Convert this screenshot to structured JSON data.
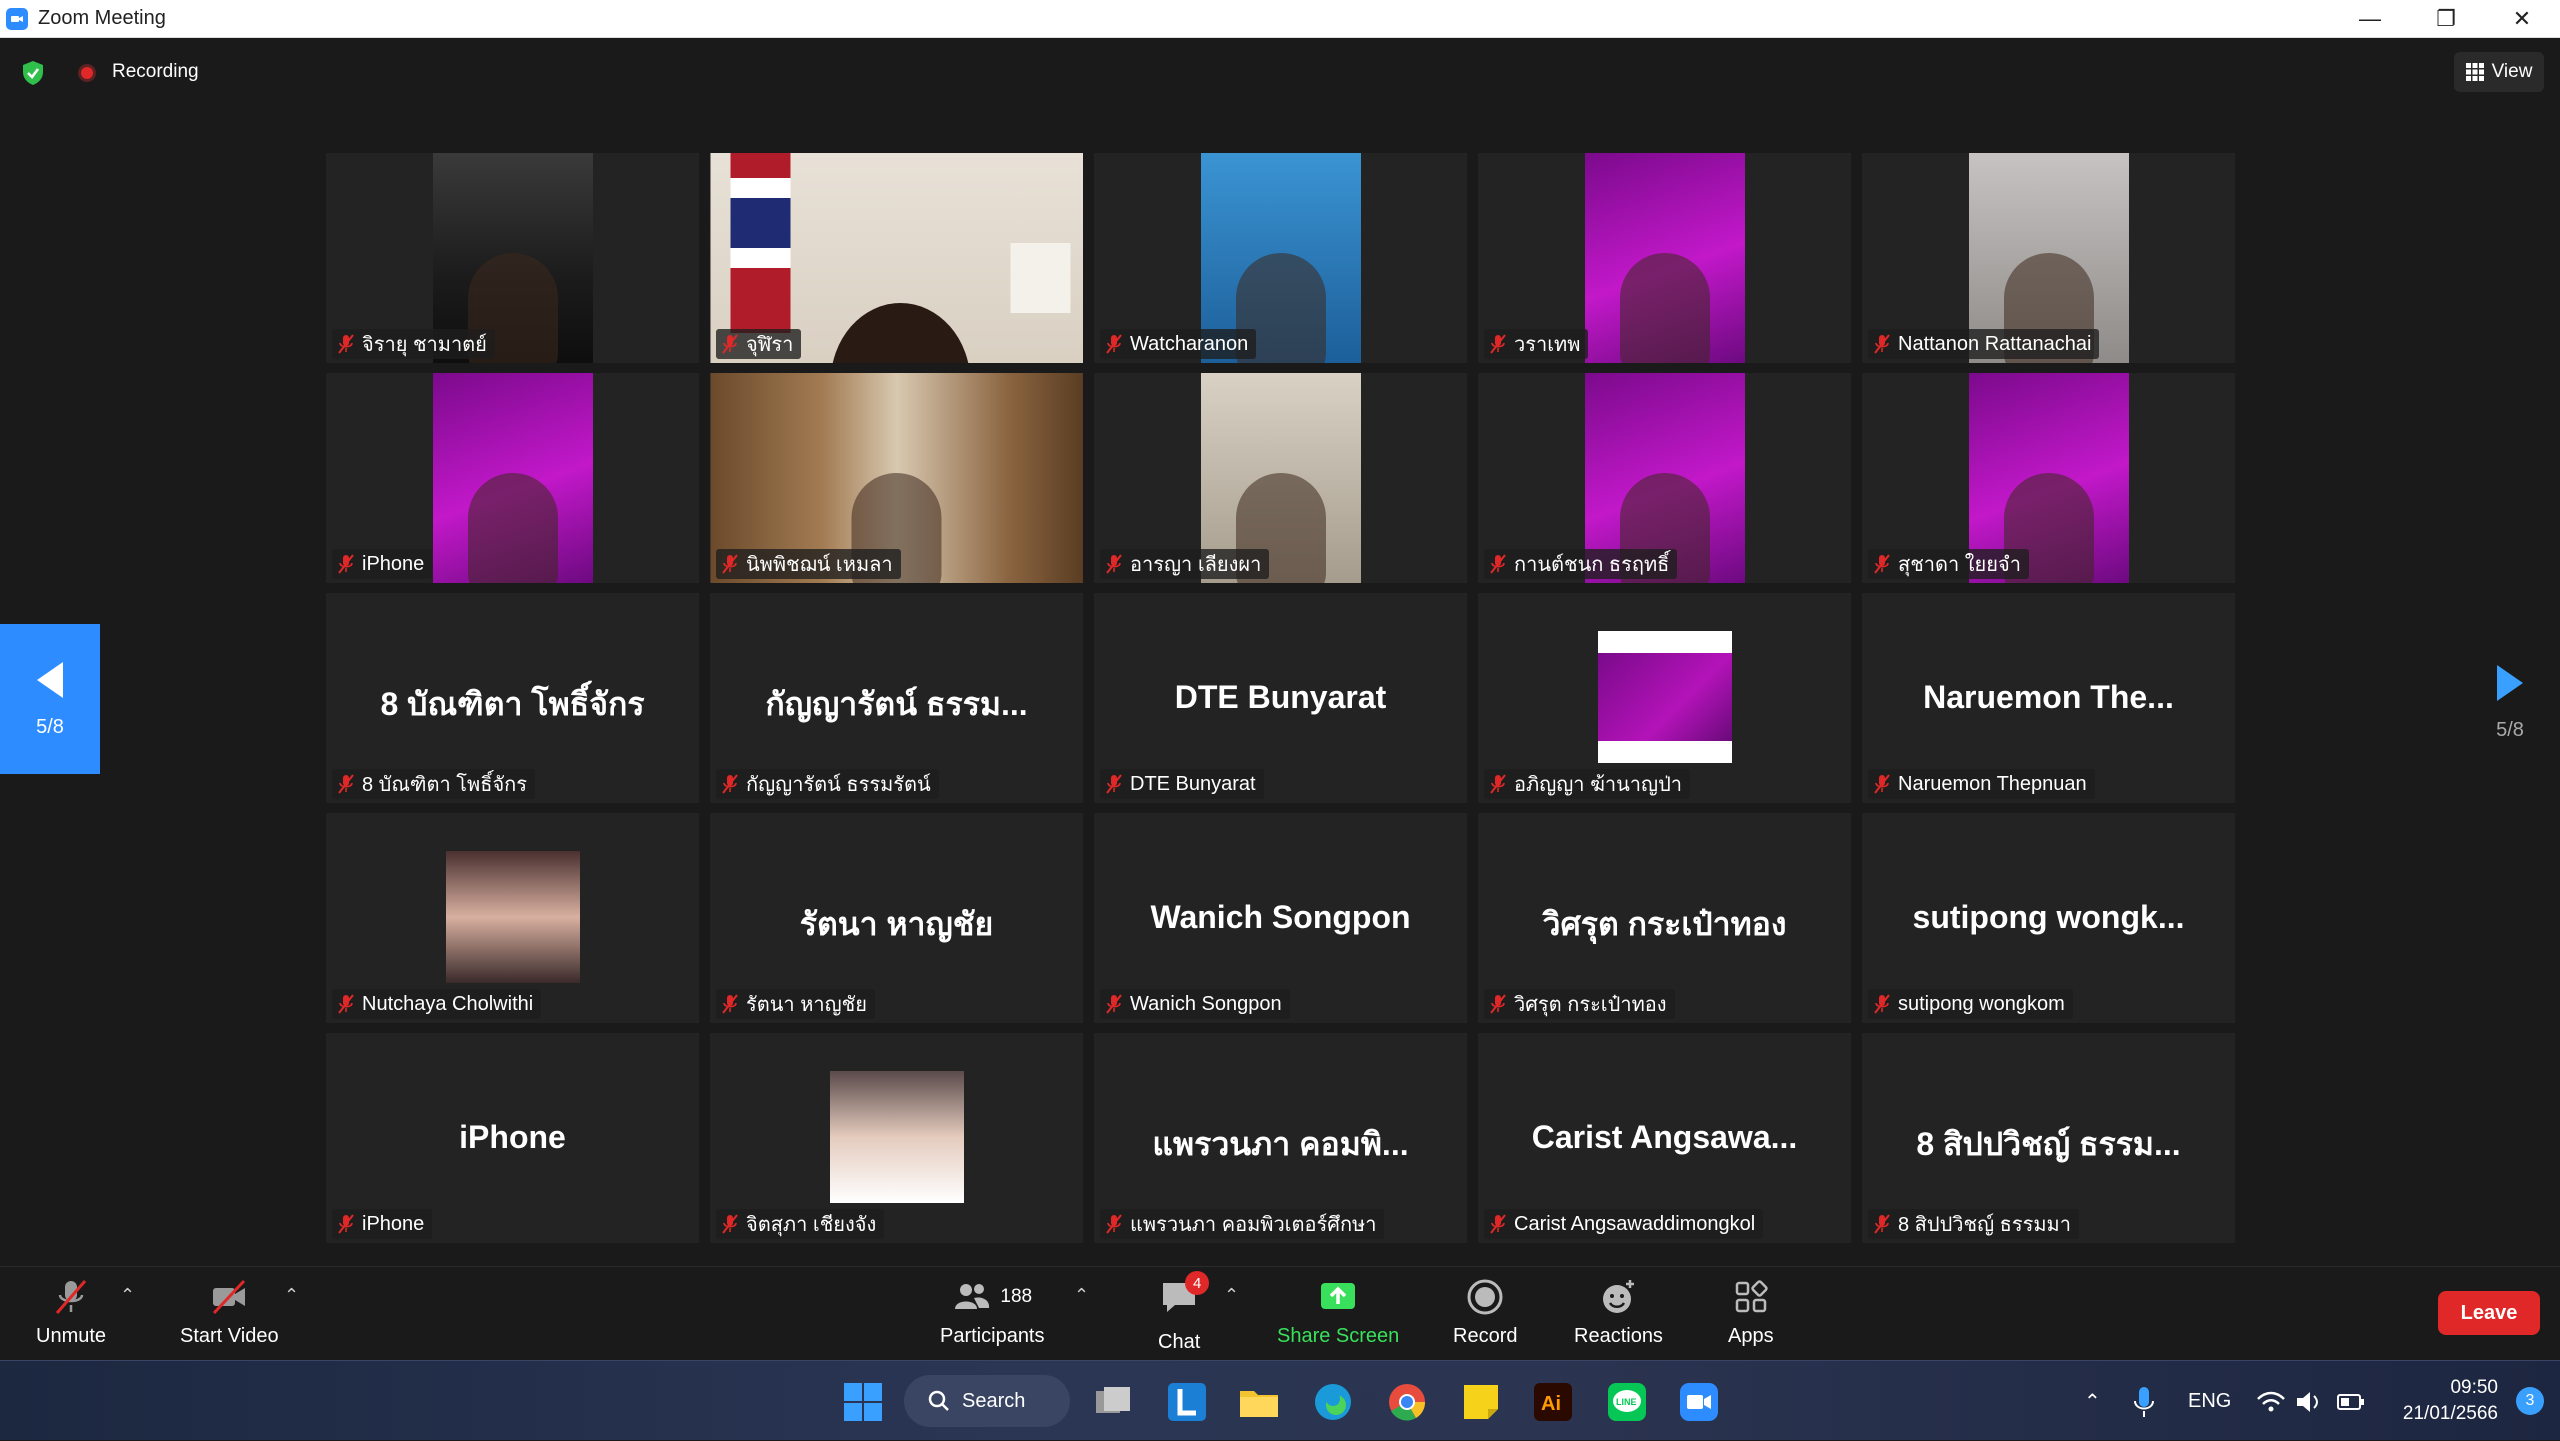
{
  "window": {
    "title": "Zoom Meeting",
    "minimize": "—",
    "restore": "❐",
    "close": "✕"
  },
  "topbar": {
    "recording_label": "Recording",
    "view_label": "View"
  },
  "pagination": {
    "left_page": "5/8",
    "right_page": "5/8"
  },
  "tiles": [
    {
      "name": "จิรายุ ชามาตย์",
      "kind": "video",
      "tone": "dark"
    },
    {
      "name": "จุฬิรา",
      "kind": "video-wide",
      "tone": "flag"
    },
    {
      "name": "Watcharanon",
      "kind": "video",
      "tone": "blue"
    },
    {
      "name": "วราเทพ",
      "kind": "video",
      "tone": "purple"
    },
    {
      "name": "Nattanon Rattanachai",
      "kind": "video",
      "tone": "room"
    },
    {
      "name": "iPhone",
      "kind": "video",
      "tone": "purple"
    },
    {
      "name": "นิพพิชฌน์ เหมลา",
      "kind": "video-wide",
      "tone": "wood"
    },
    {
      "name": "อารญา เลียงผา",
      "kind": "video",
      "tone": "beige"
    },
    {
      "name": "กานต์ชนก ธรฤทธิ์",
      "kind": "video",
      "tone": "purple"
    },
    {
      "name": "สุชาดา ใยยจำ",
      "kind": "video",
      "tone": "purple"
    },
    {
      "name": "8 บัณฑิตา  โพธิ์จักร",
      "kind": "name",
      "big": "8 บัณฑิตา  โพธิ์จักร"
    },
    {
      "name": "กัญญารัตน์ ธรรมรัตน์",
      "kind": "name",
      "big": "กัญญารัตน์ ธรรม..."
    },
    {
      "name": "DTE Bunyarat",
      "kind": "name",
      "big": "DTE Bunyarat"
    },
    {
      "name": "อภิญญา ฆ้านาญป่า",
      "kind": "share"
    },
    {
      "name": "Naruemon Thepnuan",
      "kind": "name",
      "big": "Naruemon  The..."
    },
    {
      "name": "Nutchaya Cholwithi",
      "kind": "photo",
      "tone": "portrait"
    },
    {
      "name": "รัตนา หาญชัย",
      "kind": "name",
      "big": "รัตนา หาญชัย"
    },
    {
      "name": "Wanich Songpon",
      "kind": "name",
      "big": "Wanich Songpon"
    },
    {
      "name": "วิศรุต กระเป๋าทอง",
      "kind": "name",
      "big": "วิศรุต กระเป๋าทอง"
    },
    {
      "name": "sutipong wongkom",
      "kind": "name",
      "big": "sutipong wongk..."
    },
    {
      "name": "iPhone",
      "kind": "name",
      "big": "iPhone"
    },
    {
      "name": "จิตสุภา เชียงจัง",
      "kind": "photo",
      "tone": "portrait2"
    },
    {
      "name": "แพรวนภา คอมพิวเตอร์ศึกษา",
      "kind": "name",
      "big": "แพรวนภา คอมพิ..."
    },
    {
      "name": "Carist Angsawaddimongkol",
      "kind": "name",
      "big": "Carist  Angsawa..."
    },
    {
      "name": "8 สิปปวิชญ์ ธรรมมา",
      "kind": "name",
      "big": "8 สิปปวิชญ์ ธรรม..."
    }
  ],
  "controls": {
    "unmute": "Unmute",
    "start_video": "Start Video",
    "participants": "Participants",
    "participants_count": "188",
    "chat": "Chat",
    "chat_badge": "4",
    "share_screen": "Share Screen",
    "record": "Record",
    "reactions": "Reactions",
    "apps": "Apps",
    "leave": "Leave"
  },
  "taskbar": {
    "search_label": "Search",
    "language": "ENG",
    "time": "09:50",
    "date": "21/01/2566",
    "notification_count": "3"
  },
  "colors": {
    "accent": "#2d8cff",
    "leave": "#e02828",
    "share": "#39e05b",
    "tile": "#232323"
  }
}
